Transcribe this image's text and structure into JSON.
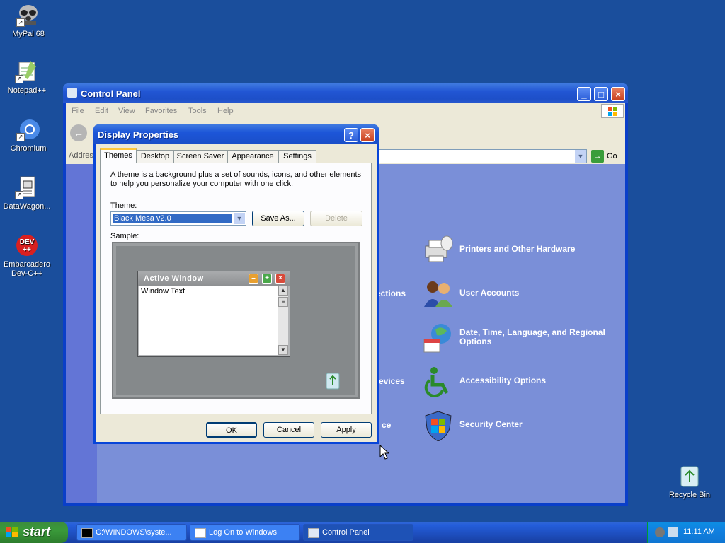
{
  "desktop": {
    "icons": [
      {
        "label": "MyPal 68"
      },
      {
        "label": "Notepad++"
      },
      {
        "label": "Chromium"
      },
      {
        "label": "DataWagon..."
      },
      {
        "label": "Embarcadero Dev-C++"
      }
    ],
    "recycle_bin": "Recycle Bin"
  },
  "control_panel": {
    "title": "Control Panel",
    "menu": [
      "File",
      "Edit",
      "View",
      "Favorites",
      "Tools",
      "Help"
    ],
    "address_label": "Address",
    "go_label": "Go",
    "items": [
      {
        "label": "Printers and Other Hardware"
      },
      {
        "label": "User Accounts"
      },
      {
        "label": "Date, Time, Language, and Regional Options"
      },
      {
        "label": "Accessibility Options"
      },
      {
        "label": "Security Center"
      }
    ],
    "partial_labels": [
      "ections",
      "evices",
      "ce"
    ]
  },
  "display_properties": {
    "title": "Display Properties",
    "help_btn": "?",
    "close_btn": "×",
    "tabs": [
      "Themes",
      "Desktop",
      "Screen Saver",
      "Appearance",
      "Settings"
    ],
    "active_tab": "Themes",
    "description": "A theme is a background plus a set of sounds, icons, and other elements to help you personalize your computer with one click.",
    "theme_label": "Theme:",
    "theme_value": "Black Mesa v2.0",
    "save_as": "Save As...",
    "delete": "Delete",
    "sample_label": "Sample:",
    "sample_window_title": "Active Window",
    "sample_window_text": "Window Text",
    "ok": "OK",
    "cancel": "Cancel",
    "apply": "Apply"
  },
  "taskbar": {
    "start": "start",
    "tasks": [
      {
        "label": "C:\\WINDOWS\\syste..."
      },
      {
        "label": "Log On to Windows"
      },
      {
        "label": "Control Panel"
      }
    ],
    "clock": "11:11 AM"
  }
}
